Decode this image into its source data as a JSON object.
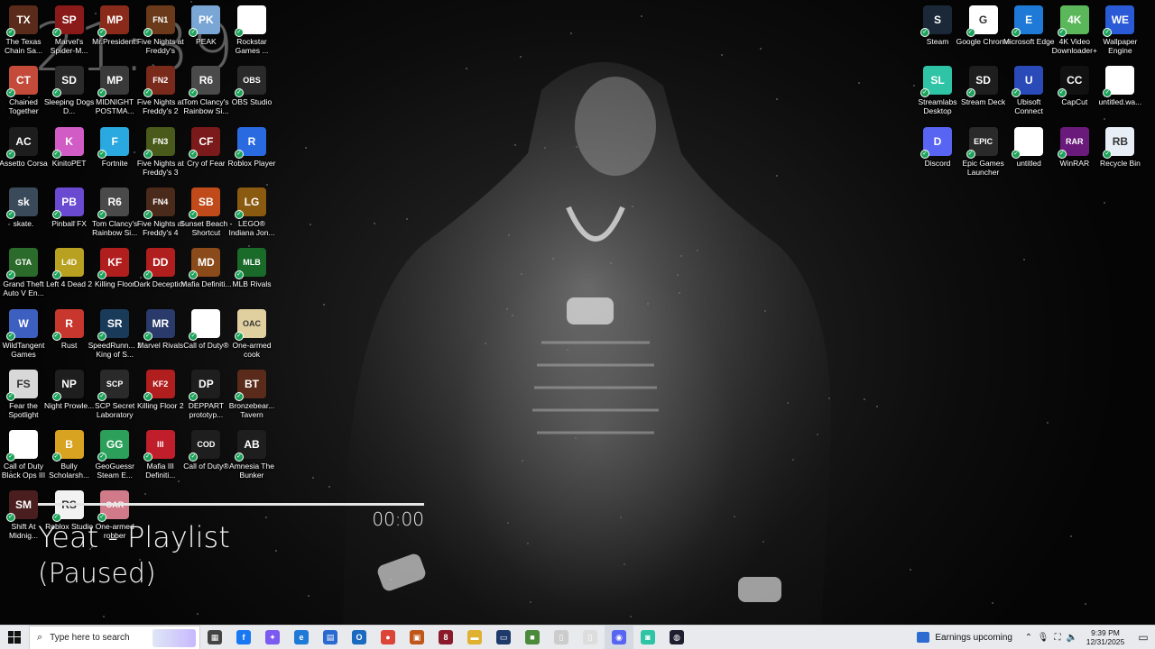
{
  "wallpaper": {
    "clock_overlay": "21:39"
  },
  "music_widget": {
    "time": "00:00",
    "title": "Yeat - Playlist",
    "status": "(Paused)"
  },
  "desktop_left": [
    [
      "The Texas Chain Sa...",
      "Chained Together",
      "Assetto Corsa",
      "skate.",
      "Grand Theft Auto V En...",
      "WildTangent Games",
      "Fear the Spotlight",
      "Call of Duty Black Ops III",
      "Shift At Midnig..."
    ],
    [
      "Marvel's Spider-M...",
      "Sleeping Dogs D...",
      "KinitoPET",
      "Pinball FX",
      "Left 4 Dead 2",
      "Rust",
      "Night Prowle...",
      "Bully Scholarsh...",
      "Roblox Studio"
    ],
    [
      "Mr.President!",
      "MIDNIGHT POSTMA...",
      "Fortnite",
      "Tom Clancy's Rainbow Si...",
      "Killing Floor",
      "SpeedRunn... 2 King of S...",
      "SCP Secret Laboratory",
      "GeoGuessr Steam E...",
      "One-armed robber"
    ],
    [
      "Five Nights at Freddy's",
      "Five Nights at Freddy's 2",
      "Five Nights at Freddy's 3",
      "Five Nights at Freddy's 4",
      "Dark Deception",
      "Marvel Rivals",
      "Killing Floor 2",
      "Mafia III Definiti...",
      ""
    ],
    [
      "PEAK",
      "Tom Clancy's Rainbow Si...",
      "Cry of Fear",
      "Sunset Beach - Shortcut",
      "Mafia Definiti...",
      "Call of Duty®",
      "DEPPART prototyp...",
      "Call of Duty®",
      ""
    ],
    [
      "Rockstar Games ...",
      "OBS Studio",
      "Roblox Player",
      "LEGO® Indiana Jon...",
      "MLB Rivals",
      "One-armed cook",
      "Bronzebear... Tavern",
      "Amnesia The Bunker",
      ""
    ]
  ],
  "desktop_right": [
    [
      "Steam",
      "Google Chrome",
      "Microsoft Edge",
      "4K Video Downloader+",
      "Wallpaper Engine"
    ],
    [
      "Streamlabs Desktop",
      "Stream Deck",
      "Ubisoft Connect",
      "CapCut",
      "untitled.wa..."
    ],
    [
      "Discord",
      "Epic Games Launcher",
      "untitled",
      "WinRAR",
      "Recycle Bin"
    ]
  ],
  "icon_glyphs": {
    "left": [
      [
        "TX",
        "CT",
        "AC",
        "sk",
        "GTA",
        "W",
        "FS",
        "",
        "SM"
      ],
      [
        "SP",
        "SD",
        "K",
        "PB",
        "L4D",
        "R",
        "NP",
        "B",
        "RS"
      ],
      [
        "MP",
        "MP",
        "F",
        "R6",
        "KF",
        "SR",
        "SCP",
        "GG",
        "OAR"
      ],
      [
        "FN1",
        "FN2",
        "FN3",
        "FN4",
        "DD",
        "MR",
        "KF2",
        "III",
        ""
      ],
      [
        "PK",
        "R6",
        "CF",
        "SB",
        "MD",
        "",
        "DP",
        "COD",
        ""
      ],
      [
        "",
        "OBS",
        "R",
        "LG",
        "MLB",
        "OAC",
        "BT",
        "AB",
        ""
      ]
    ],
    "right": [
      [
        "S",
        "G",
        "E",
        "4K",
        "WE"
      ],
      [
        "SL",
        "SD",
        "U",
        "CC",
        ""
      ],
      [
        "D",
        "EPIC",
        "",
        "RAR",
        "RB"
      ]
    ]
  },
  "icon_colors": {
    "left": [
      [
        "#5a2a1a",
        "#c44b3a",
        "#1d1d1d",
        "#3a4a5a",
        "#2a6a2a",
        "#3d5fbf",
        "#d8d8d8",
        "#ffffff",
        "#4a1e1e"
      ],
      [
        "#8a1a1a",
        "#2a2a2a",
        "#d15cc5",
        "#6a4ad0",
        "#b8a020",
        "#c8372d",
        "#1e1e1e",
        "#d8a321",
        "#f2f2f2"
      ],
      [
        "#8a2a1a",
        "#3a3a3a",
        "#2aa8e0",
        "#4a4a4a",
        "#b01e1e",
        "#1a3a5a",
        "#2a2a2a",
        "#2ca05a",
        "#d07a8a"
      ],
      [
        "#6a3a1a",
        "#7a2a1a",
        "#4a5a1a",
        "#4a2a1a",
        "#b01e1e",
        "#2a3a6a",
        "#b01e1e",
        "#c01e2a",
        ""
      ],
      [
        "#7aa6d6",
        "#4a4a4a",
        "#7a1a1a",
        "#c04a1a",
        "#8a4a1a",
        "#ffffff",
        "#1e1e1e",
        "#1e1e1e",
        ""
      ],
      [
        "#ffffff",
        "#2a2a2a",
        "#2a6ae0",
        "#8a5a10",
        "#1a6a2a",
        "#e0d0a0",
        "#5a2a1a",
        "#1e1e1e",
        ""
      ]
    ],
    "right": [
      [
        "#1b2838",
        "#ffffff",
        "#1e7ad6",
        "#5ab85a",
        "#2a5ad6"
      ],
      [
        "#2ec4a5",
        "#1e1e1e",
        "#2a4ab8",
        "#111111",
        "#ffffff"
      ],
      [
        "#5865f2",
        "#2a2a2a",
        "#ffffff",
        "#6a1a7a",
        "#e8eef6"
      ]
    ]
  },
  "taskbar": {
    "search_placeholder": "Type here to search",
    "pinned": [
      {
        "name": "task-view-icon",
        "glyph": "▦",
        "color": "#444444"
      },
      {
        "name": "facebook-icon",
        "glyph": "f",
        "color": "#1877f2"
      },
      {
        "name": "copilot-icon",
        "glyph": "✦",
        "color": "#7a5af0"
      },
      {
        "name": "edge-icon",
        "glyph": "e",
        "color": "#1e7ad6"
      },
      {
        "name": "store-icon",
        "glyph": "▤",
        "color": "#2a6ad0"
      },
      {
        "name": "outlook-icon",
        "glyph": "O",
        "color": "#1a6ac0"
      },
      {
        "name": "chrome-icon",
        "glyph": "●",
        "color": "#db4437"
      },
      {
        "name": "app-icon",
        "glyph": "▣",
        "color": "#c0561a"
      },
      {
        "name": "app-icon-2",
        "glyph": "8",
        "color": "#8a1a2a"
      },
      {
        "name": "file-explorer-icon",
        "glyph": "▬",
        "color": "#e0b030"
      },
      {
        "name": "terminal-icon",
        "glyph": "▭",
        "color": "#1e3a6a"
      },
      {
        "name": "minecraft-icon",
        "glyph": "■",
        "color": "#4a8a3a"
      },
      {
        "name": "document-icon",
        "glyph": "▯",
        "color": "#cccccc"
      },
      {
        "name": "document-icon-2",
        "glyph": "▯",
        "color": "#dddddd"
      },
      {
        "name": "discord-icon",
        "glyph": "◉",
        "color": "#5865f2"
      },
      {
        "name": "streamlabs-icon",
        "glyph": "◙",
        "color": "#2ec4a5"
      },
      {
        "name": "dark-app-icon",
        "glyph": "◍",
        "color": "#1e1e2e"
      }
    ],
    "news": "Earnings upcoming",
    "time": "9:39 PM",
    "date": "12/31/2025"
  }
}
